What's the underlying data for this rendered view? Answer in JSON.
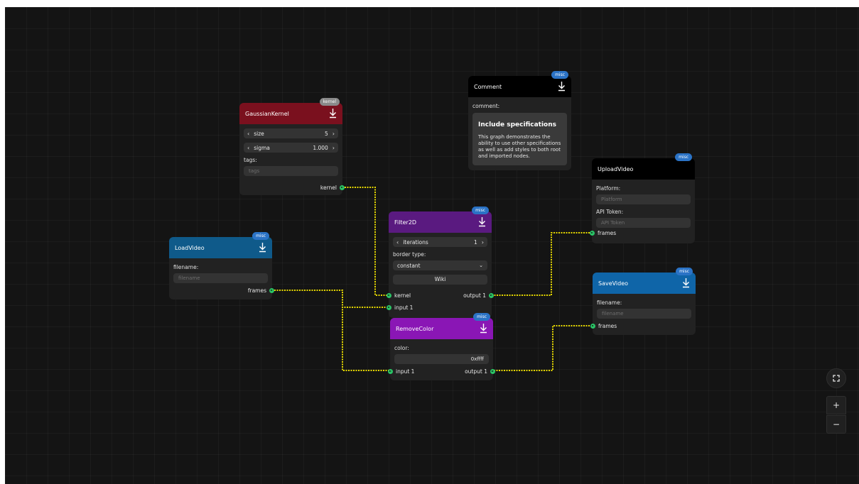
{
  "colors": {
    "background": "#141414",
    "wire": "#e6d800",
    "port": "#2ac466"
  },
  "nodes": {
    "gaussian": {
      "title": "GaussianKernel",
      "badge": "kernel",
      "header_color": "#7a101e",
      "badge_color": "#8a8a8a",
      "size_label": "size",
      "size_value": "5",
      "sigma_label": "sigma",
      "sigma_value": "1.000",
      "tags_label": "tags:",
      "tags_placeholder": "tags",
      "out_kernel": "kernel"
    },
    "comment": {
      "title": "Comment",
      "badge": "misc",
      "header_color": "#000000",
      "badge_color": "#2b73c6",
      "comment_label": "comment:",
      "heading": "Include specifications",
      "text": "This graph demonstrates the ability to use other specifications as well as add styles to both root and imported nodes."
    },
    "upload": {
      "title": "UploadVideo",
      "badge": "misc",
      "header_color": "#000000",
      "badge_color": "#2b73c6",
      "platform_label": "Platform:",
      "platform_placeholder": "Platform",
      "token_label": "API Token:",
      "token_placeholder": "API Token",
      "in_frames": "frames"
    },
    "filter": {
      "title": "Filter2D",
      "badge": "misc",
      "header_color": "#5a1a80",
      "badge_color": "#2b73c6",
      "iterations_label": "iterations",
      "iterations_value": "1",
      "border_label": "border type:",
      "border_value": "constant",
      "wiki_label": "Wiki",
      "in_kernel": "kernel",
      "in_input": "input 1",
      "out_output": "output 1"
    },
    "load": {
      "title": "LoadVideo",
      "badge": "misc",
      "header_color": "#0f5a8a",
      "badge_color": "#2b73c6",
      "filename_label": "filename:",
      "filename_placeholder": "filename",
      "out_frames": "frames"
    },
    "save": {
      "title": "SaveVideo",
      "badge": "misc",
      "header_color": "#0f65a8",
      "badge_color": "#2b73c6",
      "filename_label": "filename:",
      "filename_placeholder": "filename",
      "in_frames": "frames"
    },
    "remove": {
      "title": "RemoveColor",
      "badge": "misc",
      "header_color": "#8a16b5",
      "badge_color": "#2b73c6",
      "color_label": "color:",
      "color_value": "0xffff",
      "in_input": "input 1",
      "out_output": "output 1"
    }
  },
  "controls": {
    "fullscreen_icon": "fullscreen-icon",
    "zoom_in_label": "+",
    "zoom_out_label": "−"
  }
}
